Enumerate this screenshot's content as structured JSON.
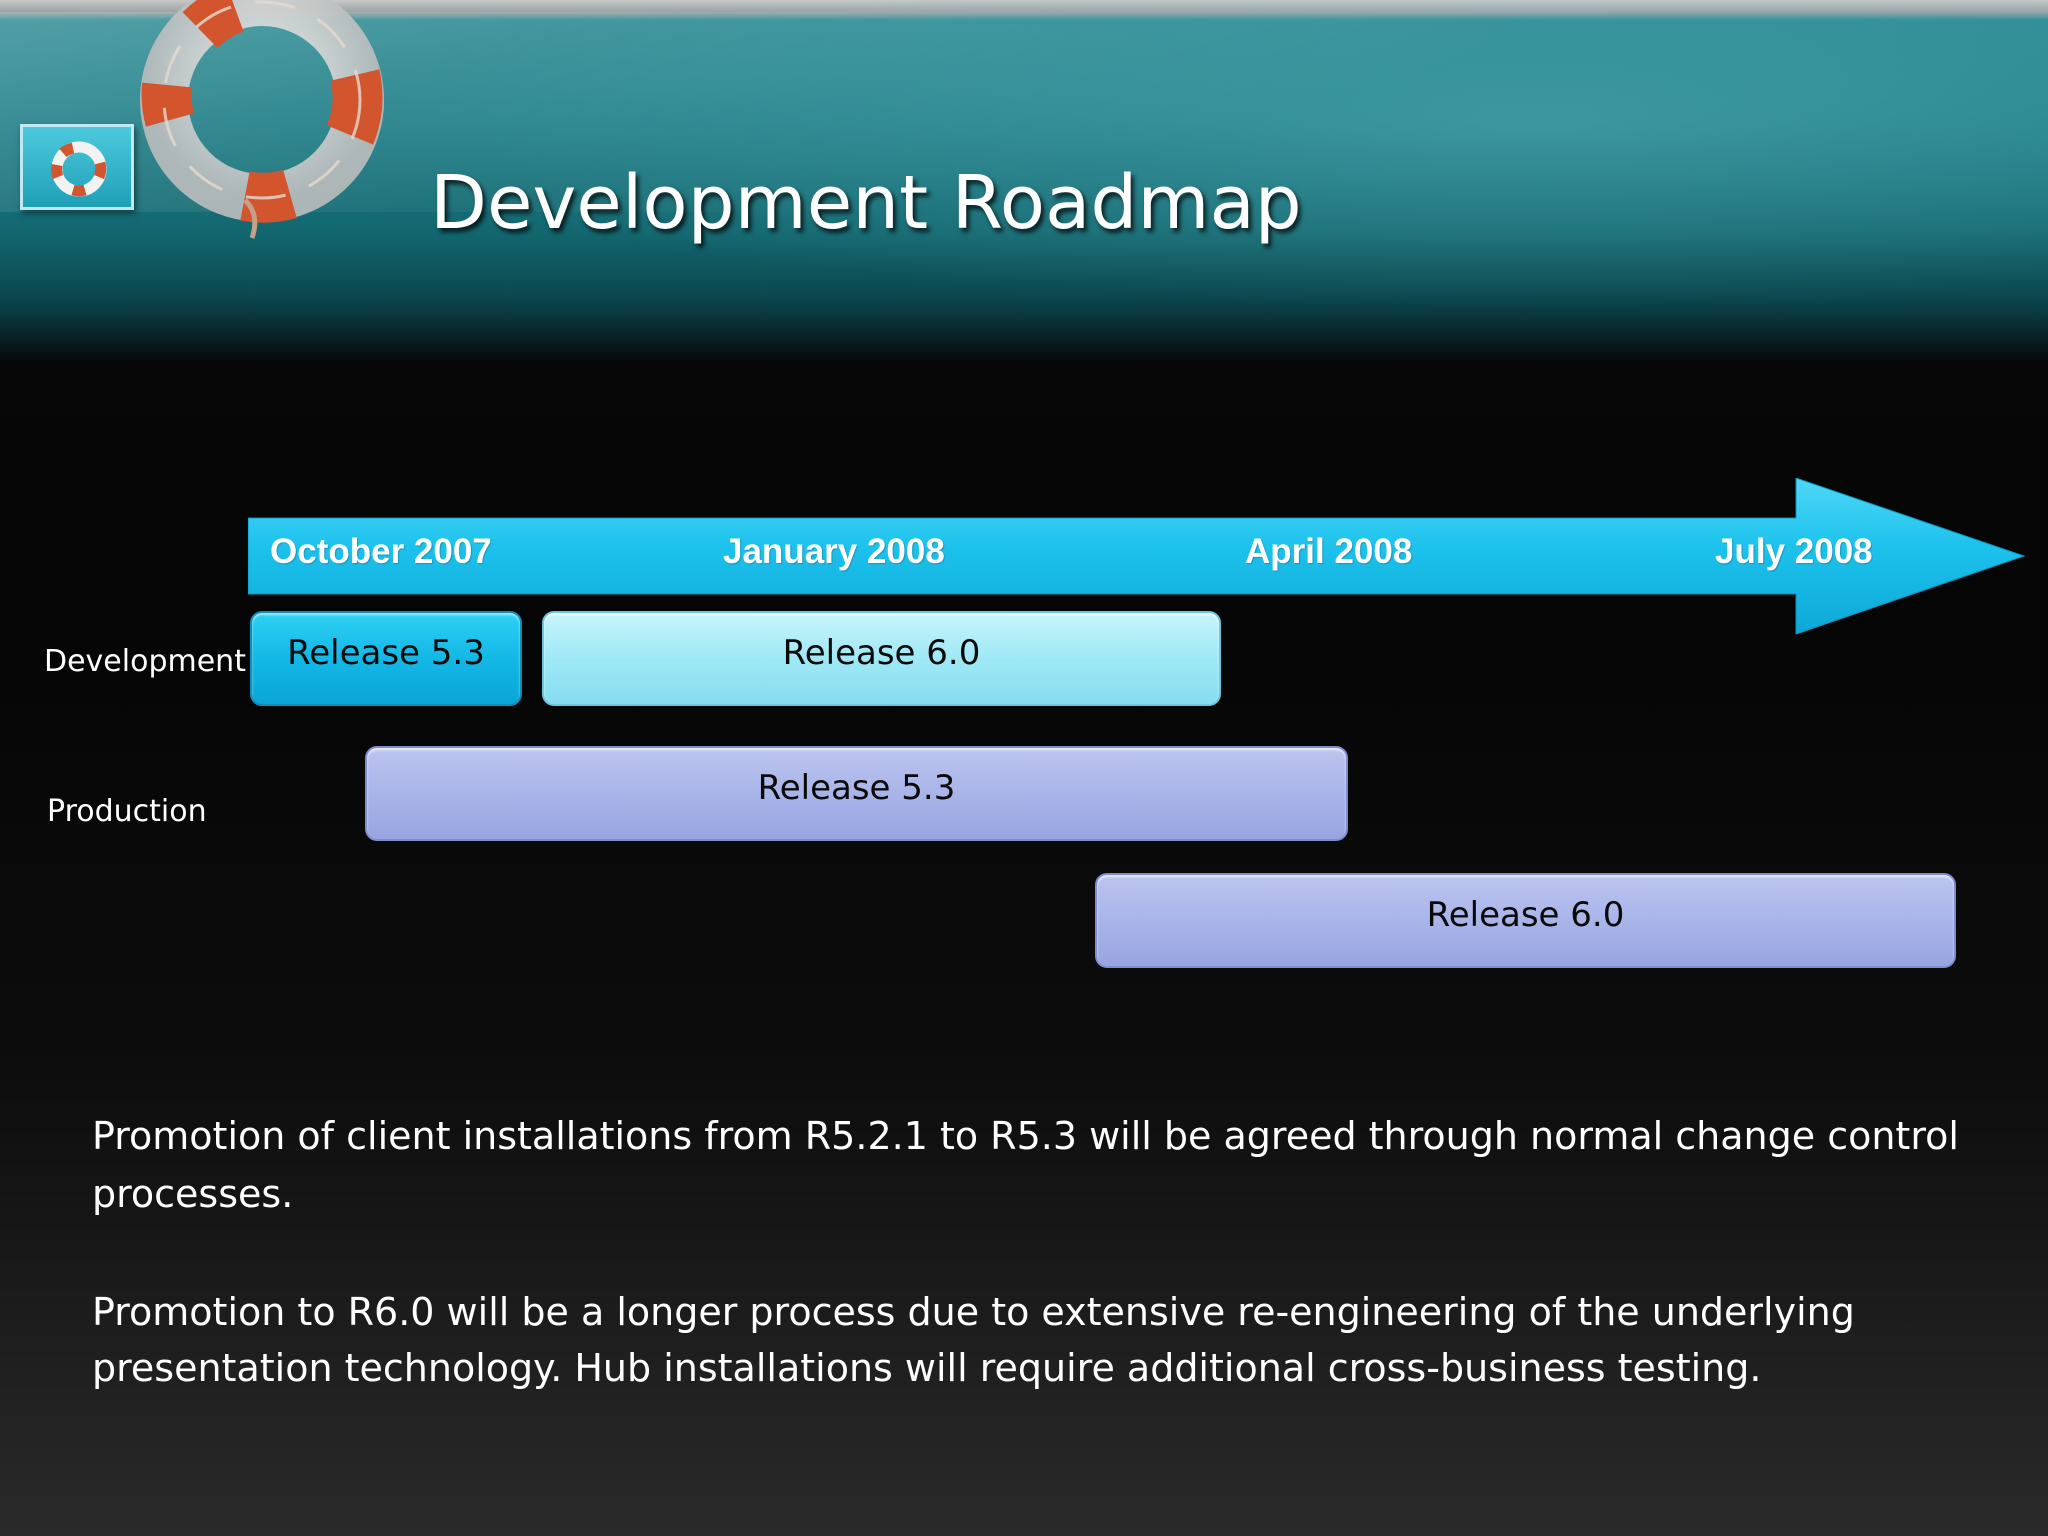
{
  "slide": {
    "title": "Development Roadmap"
  },
  "timeline": {
    "months": [
      "October 2007",
      "January 2008",
      "April 2008",
      "July 2008"
    ],
    "arrow_color": "#1cc1ec"
  },
  "rows": {
    "development_label": "Development",
    "production_label": "Production"
  },
  "bars": {
    "dev_release_53": "Release 5.3",
    "dev_release_60": "Release 6.0",
    "prod_release_53": "Release 5.3",
    "prod_release_60": "Release 6.0"
  },
  "notes": {
    "paragraph_1": "Promotion of client installations from R5.2.1 to R5.3 will be agreed through normal change control processes.",
    "paragraph_2": "Promotion to R6.0 will be a longer process due to extensive re-engineering of the underlying presentation technology. Hub installations will require additional cross-business testing."
  },
  "colors": {
    "header_teal": "#1d7d86",
    "dev_bar_primary": "#13b8e6",
    "dev_bar_light": "#9fe9f6",
    "prod_bar": "#a9b4e9"
  },
  "icons": [
    "life-ring-icon",
    "life-ring-thumbnail-icon"
  ]
}
